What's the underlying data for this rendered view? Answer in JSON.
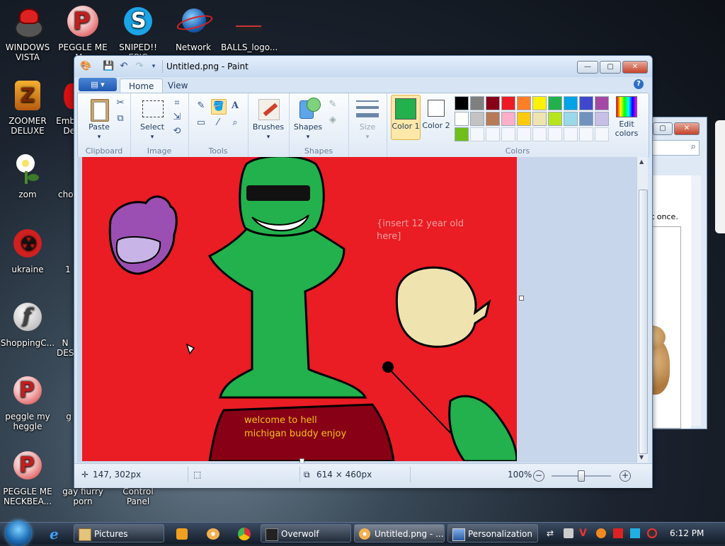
{
  "desktop_icons": [
    {
      "id": "windows-vista",
      "label": "WINDOWS VISTA"
    },
    {
      "id": "peggle-me",
      "label": "PEGGLE ME M..."
    },
    {
      "id": "sniped-epic",
      "label": "SNIPED!! EPIC"
    },
    {
      "id": "network",
      "label": "Network"
    },
    {
      "id": "balls-logo",
      "label": "BALLS_logo..."
    },
    {
      "id": "zoomer-deluxe",
      "label": "ZOOMER DELUXE"
    },
    {
      "id": "emb-de",
      "label": "Emb De"
    },
    {
      "id": "zom",
      "label": "zom"
    },
    {
      "id": "cho",
      "label": "cho"
    },
    {
      "id": "ukraine",
      "label": "ukraine"
    },
    {
      "id": "one",
      "label": "1"
    },
    {
      "id": "shopping",
      "label": "ShoppingC..."
    },
    {
      "id": "desk",
      "label": "N DES"
    },
    {
      "id": "peggle-my-heggle",
      "label": "peggle my heggle"
    },
    {
      "id": "g",
      "label": "g"
    },
    {
      "id": "peggle-me-neckbea",
      "label": "PEGGLE ME NECKBEA..."
    },
    {
      "id": "gay-fiurry-porn",
      "label": "gay fiurry porn"
    },
    {
      "id": "control-panel",
      "label": "Control Panel"
    }
  ],
  "paint": {
    "title": "Untitled.png - Paint",
    "tabs": {
      "home": "Home",
      "view": "View"
    },
    "groups": {
      "clipboard": "Clipboard",
      "image": "Image",
      "tools": "Tools",
      "shapes": "Shapes",
      "colors": "Colors"
    },
    "buttons": {
      "paste": "Paste",
      "select": "Select",
      "brushes": "Brushes",
      "shapes": "Shapes",
      "size": "Size",
      "color1": "Color 1",
      "color2": "Color 2",
      "edit_colors": "Edit colors"
    },
    "palette_row1": [
      "#000000",
      "#7f7f7f",
      "#880015",
      "#ed1c24",
      "#ff7f27",
      "#fff200",
      "#22b14c",
      "#00a2e8",
      "#3f48cc",
      "#a349a4"
    ],
    "palette_row2": [
      "#ffffff",
      "#c3c3c3",
      "#b97a57",
      "#ffaec9",
      "#ffc90e",
      "#efe4b0",
      "#b5e61d",
      "#99d9ea",
      "#7092be",
      "#c8bfe7"
    ],
    "palette_row3": [
      "#6fbf1b"
    ],
    "color1": "#22b14c",
    "color2": "#ffffff",
    "canvas": {
      "text_kid": "{insert 12 year old",
      "text_kid2": "here]",
      "text_hell": "welcome to hell",
      "text_hell2": "michigan buddy enjoy"
    },
    "status": {
      "cursor_pos": "147, 302px",
      "image_size": "614 × 460px",
      "zoom": "100%"
    }
  },
  "bg_window": {
    "snippet": "t once."
  },
  "taskbar": {
    "pictures": "Pictures",
    "overwolf": "Overwolf",
    "paint": "Untitled.png - ...",
    "personalization": "Personalization",
    "clock": "6:12 PM"
  }
}
